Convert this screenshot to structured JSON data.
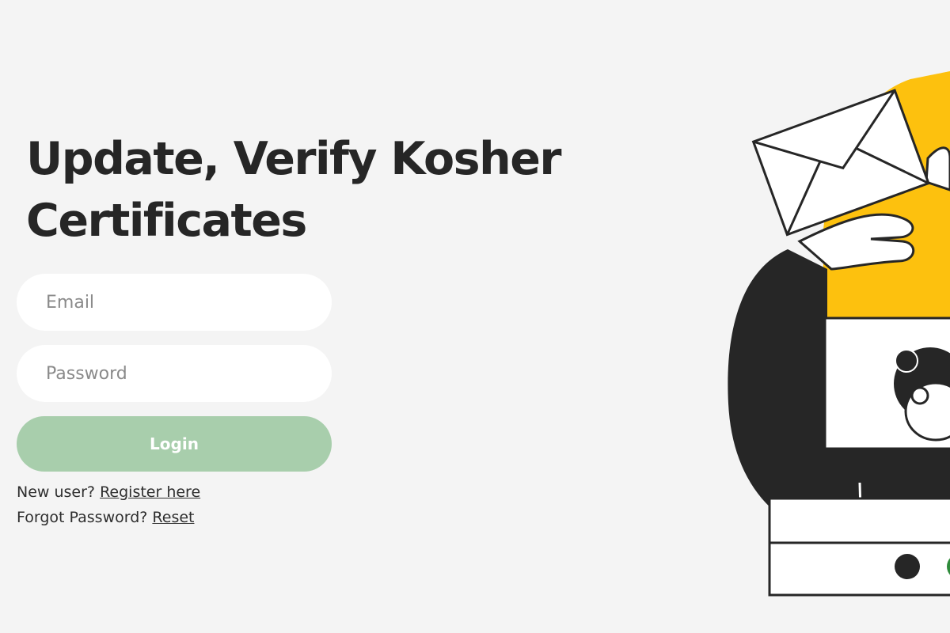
{
  "heading": {
    "line1": "Update, Verify Kosher",
    "line2": "Certificates"
  },
  "form": {
    "email_placeholder": "Email",
    "password_placeholder": "Password",
    "login_label": "Login"
  },
  "links": {
    "register_prompt": "New user?",
    "register_link": "Register here",
    "forgot_prompt": "Forgot Password?",
    "reset_link": "Reset"
  },
  "colors": {
    "background": "#f4f4f4",
    "login_button": "#a8ceac",
    "accent_yellow": "#fdc10e",
    "dark": "#262626",
    "status_green": "#2e8b3a"
  },
  "illustration": {
    "icons": [
      "envelope-icon",
      "person-figure",
      "status-dot-dark",
      "status-dot-green"
    ]
  }
}
